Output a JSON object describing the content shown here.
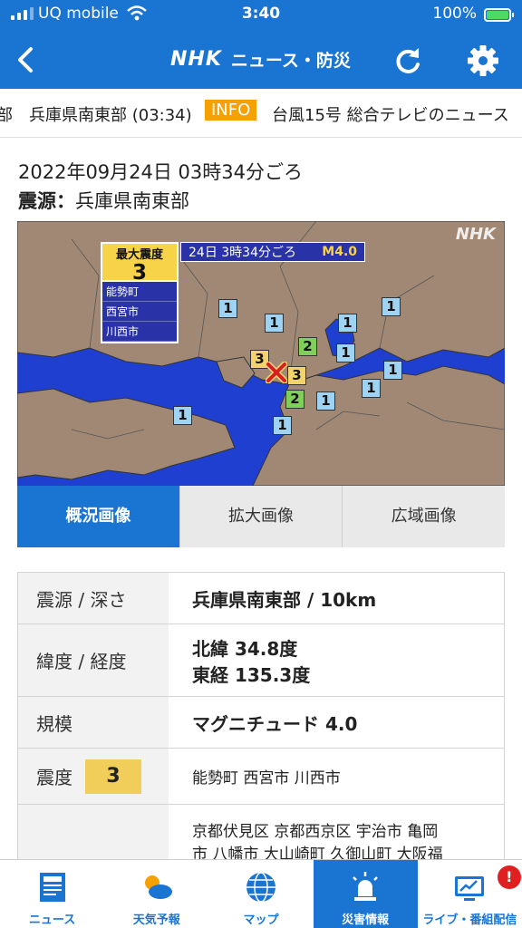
{
  "status_bar": {
    "carrier": "UQ mobile",
    "time": "3:40",
    "battery": "100%"
  },
  "header": {
    "logo": "NHK",
    "title": "ニュース・防災"
  },
  "ticker": {
    "item1": "部　兵庫県南東部 (03:34)",
    "info_badge": "INFO",
    "item2": "台風15号 総合テレビのニュース"
  },
  "quake": {
    "datetime": "2022年09月24日 03時34分ごろ",
    "epicenter_label": "震源：",
    "epicenter": "兵庫県南東部",
    "map": {
      "watermark": "NHK",
      "max_intensity_label": "最大震度",
      "max_intensity": "3",
      "cities": [
        "能勢町",
        "西宮市",
        "川西市"
      ],
      "time_label": "24日 3時34分ごろ",
      "magnitude": "M4.0",
      "markers": [
        "1",
        "1",
        "1",
        "1",
        "1",
        "2",
        "1",
        "3",
        "3",
        "2",
        "1",
        "1",
        "1",
        "1"
      ]
    },
    "tabs": [
      "概況画像",
      "拡大画像",
      "広域画像"
    ],
    "table": {
      "depth_label": "震源 / 深さ",
      "depth_value": "兵庫県南東部 / 10km",
      "latlon_label": "緯度 / 経度",
      "lat": "北緯 34.8度",
      "lon": "東経 135.3度",
      "scale_label": "規模",
      "scale_value": "マグニチュード 4.0",
      "intensity_label": "震度",
      "intensity_badge": "3",
      "intensity_places": "能勢町  西宮市  川西市",
      "intensity2_places_line1": "京都伏見区  京都西京区  宇治市  亀岡",
      "intensity2_places_line2": "市  八幡市  大山崎町  久御山町  大阪福"
    }
  },
  "bottom_nav": [
    {
      "label": "ニュース",
      "icon": "newspaper-icon"
    },
    {
      "label": "天気予報",
      "icon": "weather-icon"
    },
    {
      "label": "マップ",
      "icon": "globe-icon"
    },
    {
      "label": "災害情報",
      "icon": "alert-siren-icon"
    },
    {
      "label": "ライブ・番組配信",
      "icon": "live-tv-icon",
      "badge": "!"
    }
  ],
  "colors": {
    "primary": "#1a74d2",
    "info": "#f5a100",
    "intensity3": "#f1cd5a"
  }
}
